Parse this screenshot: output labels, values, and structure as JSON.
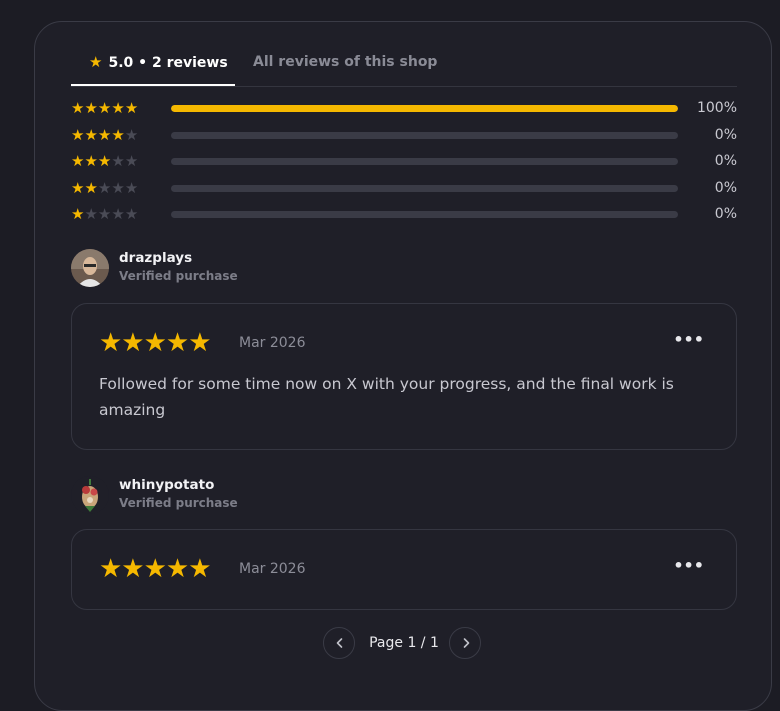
{
  "tabs": {
    "active_star": "★",
    "active_label": "5.0 • 2 reviews",
    "inactive_label": "All reviews of this shop"
  },
  "distribution": [
    {
      "stars": 5,
      "percent_label": "100%",
      "fill_fraction": 1.0
    },
    {
      "stars": 4,
      "percent_label": "0%",
      "fill_fraction": 0
    },
    {
      "stars": 3,
      "percent_label": "0%",
      "fill_fraction": 0
    },
    {
      "stars": 2,
      "percent_label": "0%",
      "fill_fraction": 0
    },
    {
      "stars": 1,
      "percent_label": "0%",
      "fill_fraction": 0
    }
  ],
  "reviews": [
    {
      "name": "drazplays",
      "verified": "Verified purchase",
      "stars": "★★★★★",
      "date": "Mar 2026",
      "text": "Followed for some time now on X with your progress, and the final work is amazing",
      "menu": "•••"
    },
    {
      "name": "whinypotato",
      "verified": "Verified purchase",
      "stars": "★★★★★",
      "date": "Mar 2026",
      "text": "",
      "menu": "•••"
    }
  ],
  "pagination": {
    "label": "Page 1 / 1"
  },
  "colors": {
    "accent_star": "#f5b800",
    "background": "#1c1c24",
    "panel": "#1f1f28"
  }
}
